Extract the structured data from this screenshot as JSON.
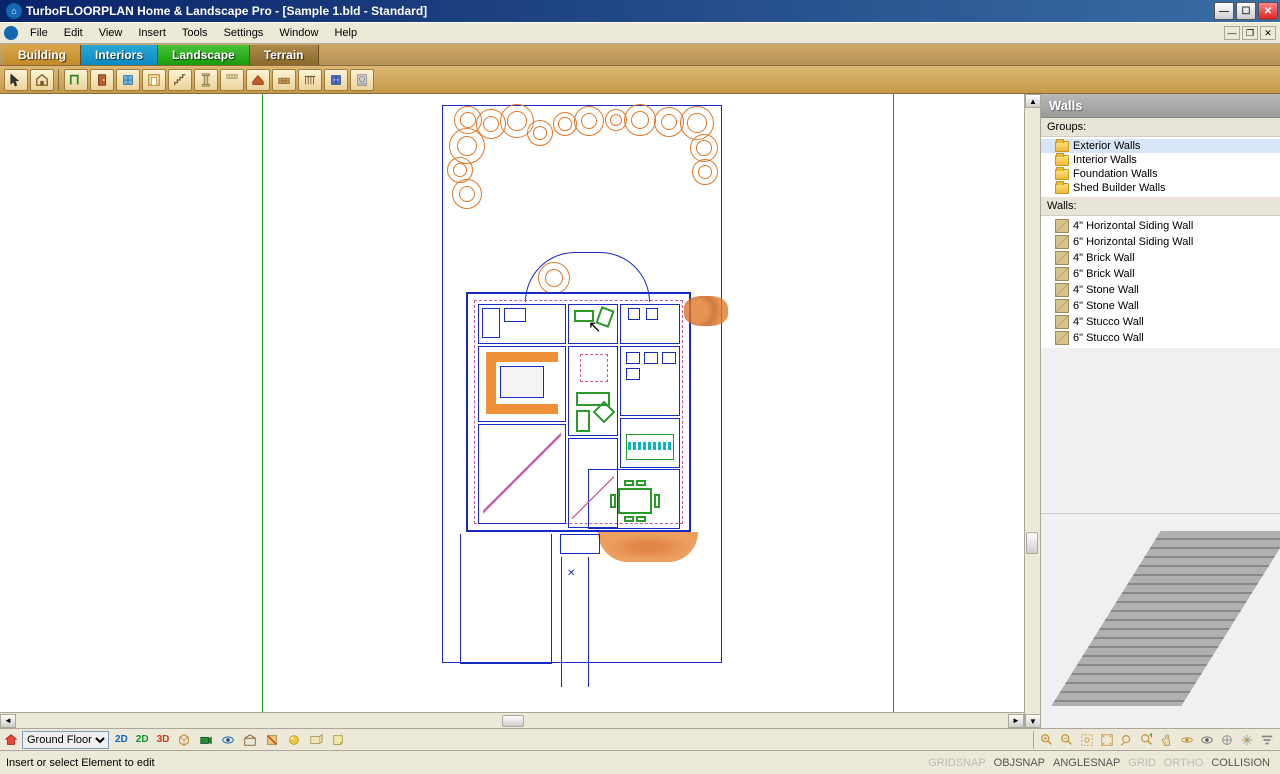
{
  "title": "TurboFLOORPLAN Home & Landscape Pro - [Sample 1.bld - Standard]",
  "menu": [
    "File",
    "Edit",
    "View",
    "Insert",
    "Tools",
    "Settings",
    "Window",
    "Help"
  ],
  "tabs": [
    {
      "name": "Building",
      "cls": "building"
    },
    {
      "name": "Interiors",
      "cls": "interiors"
    },
    {
      "name": "Landscape",
      "cls": "landscape"
    },
    {
      "name": "Terrain",
      "cls": "terrain"
    }
  ],
  "panel": {
    "title": "Walls",
    "groups_label": "Groups:",
    "groups": [
      "Exterior Walls",
      "Interior Walls",
      "Foundation Walls",
      "Shed Builder Walls"
    ],
    "walls_label": "Walls:",
    "walls": [
      "4\" Horizontal Siding Wall",
      "6\" Horizontal Siding Wall",
      "4\" Brick Wall",
      "6\" Brick Wall",
      "4\" Stone Wall",
      "6\" Stone Wall",
      "4\" Stucco Wall",
      "6\" Stucco Wall"
    ]
  },
  "floor_selector": "Ground Floor",
  "view_buttons": [
    "2D",
    "2D",
    "3D"
  ],
  "status_text": "Insert or select Element to edit",
  "status_opts": [
    {
      "t": "GRIDSNAP",
      "disabled": true
    },
    {
      "t": "OBJSNAP",
      "disabled": false
    },
    {
      "t": "ANGLESNAP",
      "disabled": false
    },
    {
      "t": "GRID",
      "disabled": true
    },
    {
      "t": "ORTHO",
      "disabled": true
    },
    {
      "t": "COLLISION",
      "disabled": false
    }
  ]
}
